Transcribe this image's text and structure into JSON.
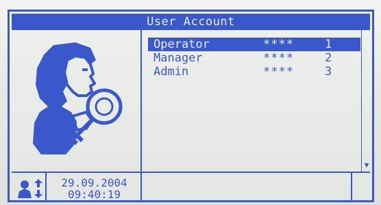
{
  "window": {
    "title": "User Account"
  },
  "users": [
    {
      "name": "Operator",
      "pin": "****",
      "level": "1",
      "selected": true
    },
    {
      "name": "Manager",
      "pin": "****",
      "level": "2",
      "selected": false
    },
    {
      "name": "Admin",
      "pin": "****",
      "level": "3",
      "selected": false
    }
  ],
  "status": {
    "date": "29.09.2004",
    "time": "09:40:19"
  },
  "icons": {
    "avatar": "user-with-key-icon",
    "status": "user-switch-icon",
    "scroll": "scroll-down-arrow-icon"
  },
  "colors": {
    "lcd_ink": "#3a58cc",
    "lcd_background": "#e9ebe8"
  }
}
